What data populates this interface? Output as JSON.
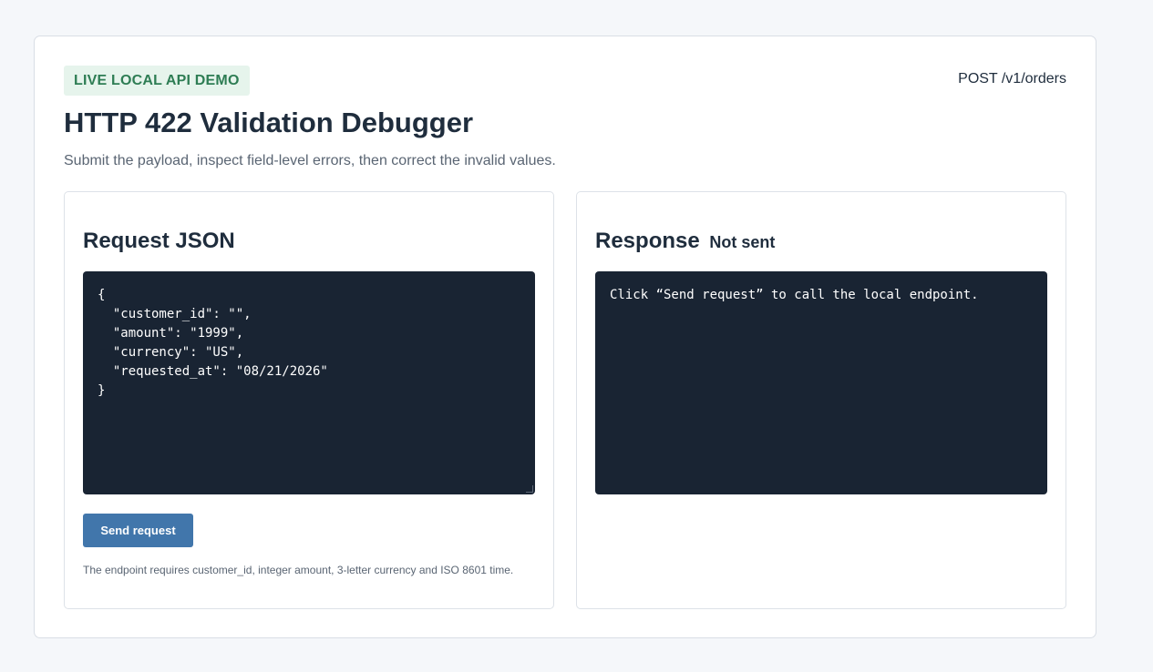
{
  "header": {
    "badge": "LIVE LOCAL API DEMO",
    "endpoint": "POST /v1/orders",
    "title": "HTTP 422 Validation Debugger",
    "subtitle": "Submit the payload, inspect field-level errors, then correct the invalid values."
  },
  "request": {
    "heading": "Request JSON",
    "body": "{\n  \"customer_id\": \"\",\n  \"amount\": \"1999\",\n  \"currency\": \"US\",\n  \"requested_at\": \"08/21/2026\"\n}",
    "send_label": "Send request",
    "hint": "The endpoint requires customer_id, integer amount, 3-letter currency and ISO 8601 time."
  },
  "response": {
    "heading": "Response",
    "status": "Not sent",
    "body": "Click “Send request” to call the local endpoint."
  },
  "colors": {
    "accent": "#4176ab",
    "badge_bg": "#e6f4ec",
    "badge_text": "#2e7d54",
    "code_bg": "#192433"
  }
}
